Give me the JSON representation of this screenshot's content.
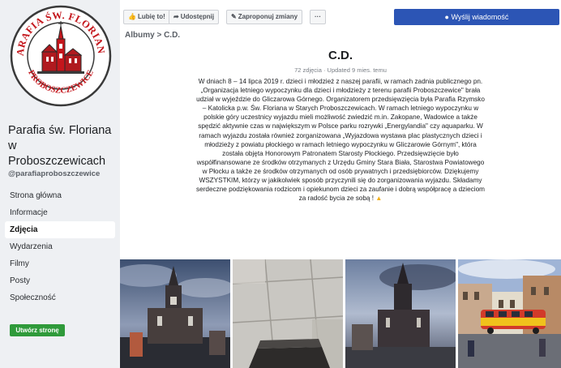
{
  "sidebar": {
    "logo_text_top": "PARAFIA ŚW. FLORIANA",
    "logo_text_bottom": "PROBOSZCZEWICE",
    "page_name_line1": "Parafia św. Floriana",
    "page_name_line2": "w",
    "page_name_line3": "Proboszczewicach",
    "handle": "@parafiaproboszczewice",
    "nav": [
      {
        "label": "Strona główna",
        "active": false
      },
      {
        "label": "Informacje",
        "active": false
      },
      {
        "label": "Zdjęcia",
        "active": true
      },
      {
        "label": "Wydarzenia",
        "active": false
      },
      {
        "label": "Filmy",
        "active": false
      },
      {
        "label": "Posty",
        "active": false
      },
      {
        "label": "Społeczność",
        "active": false
      }
    ],
    "create_button": "Utwórz stronę"
  },
  "actionbar": {
    "like": "Lubię to!",
    "share": "Udostępnij",
    "suggest": "Zaproponuj zmiany",
    "more": "···",
    "message": "Wyślij wiadomość"
  },
  "breadcrumb": "Albumy > C.D.",
  "album": {
    "title": "C.D.",
    "meta": "72 zdjęcia · Updated 9 mies. temu",
    "description": "W dniach 8 – 14 lipca 2019 r. dzieci i młodzież z naszej parafii, w ramach zadnia publicznego pn. „Organizacja letniego wypoczynku dla dzieci i młodzieży z terenu parafii Proboszczewice\" brała udział w wyjeździe do Gliczarowa Górnego. Organizatorem przedsięwzięcia była Parafia Rzymsko – Katolicka p.w. Św. Floriana w Starych Proboszczewicach. W ramach letniego wypoczynku w polskie góry uczestnicy wyjazdu mieli możliwość zwiedzić m.in. Zakopane, Wadowice a także spędzić aktywnie czas w największym w Polsce parku rozrywki „Energylandia\" czy aquaparku. W ramach wyjazdu została również zorganizowana „Wyjazdowa wystawa plac plastycznych dzieci i młodzieży z powiatu płockiego w ramach letniego wypoczynku w Gliczarowie Górnym\", która została objęta Honorowym Patronatem Starosty Płockiego. Przedsięwzięcie było współfinansowane ze środków otrzymanych z Urzędu Gminy Stara Biała, Starostwa Powiatowego w Płocku a także ze środków otrzymanych od osób prywatnych i przedsiębiorców. Dziękujemy WSZYSTKIM, którzy w jakikolwiek sposób przyczynili się do zorganizowania wyjazdu. Składamy serdeczne podziękowania rodzicom i opiekunom dzieci za zaufanie i dobrą współpracę a dzieciom za radość bycia ze sobą !"
  },
  "colors": {
    "accent_blue": "#2c55b5",
    "create_green": "#2f9a3a",
    "logo_red": "#c4161c"
  },
  "icons": [
    "like-icon",
    "share-icon",
    "pencil-icon",
    "messenger-icon",
    "church-icon",
    "emoji-icon"
  ]
}
